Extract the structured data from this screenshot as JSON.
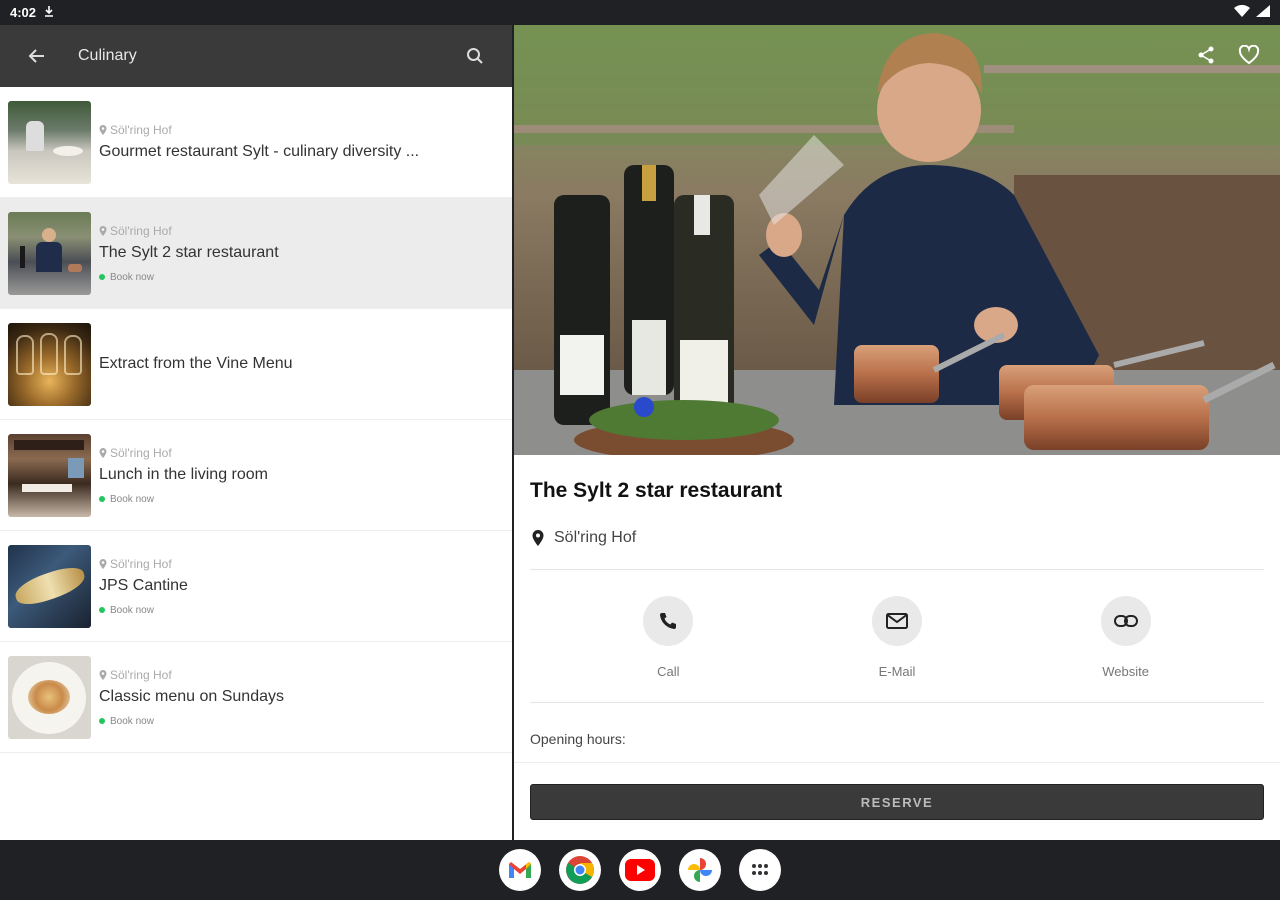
{
  "status_bar": {
    "time": "4:02"
  },
  "app_bar": {
    "title": "Culinary"
  },
  "list": {
    "items": [
      {
        "location": "Söl'ring Hof",
        "title": "Gourmet restaurant Sylt - culinary diversity ...",
        "book": ""
      },
      {
        "location": "Söl'ring Hof",
        "title": "The Sylt 2 star restaurant",
        "book": "Book now"
      },
      {
        "location": "",
        "title": "Extract from the Vine Menu",
        "book": ""
      },
      {
        "location": "Söl'ring Hof",
        "title": "Lunch in the living room",
        "book": "Book now"
      },
      {
        "location": "Söl'ring Hof",
        "title": "JPS Cantine",
        "book": "Book now"
      },
      {
        "location": "Söl'ring Hof",
        "title": "Classic menu on Sundays",
        "book": "Book now"
      }
    ]
  },
  "detail": {
    "title": "The Sylt 2 star restaurant",
    "location": "Söl'ring Hof",
    "actions": {
      "call": "Call",
      "email": "E-Mail",
      "website": "Website"
    },
    "hours_label": "Opening hours:",
    "reserve_label": "RESERVE"
  },
  "colors": {
    "app_bar": "#3a3a3a",
    "book_dot": "#22c55e",
    "selected_row": "#ececec"
  },
  "icons": [
    "back-arrow-icon",
    "search-icon",
    "location-pin-icon",
    "share-icon",
    "heart-icon",
    "phone-icon",
    "mail-icon",
    "link-icon"
  ],
  "taskbar": {
    "apps": [
      "gmail-icon",
      "chrome-icon",
      "youtube-icon",
      "photos-icon",
      "app-drawer-icon"
    ]
  }
}
